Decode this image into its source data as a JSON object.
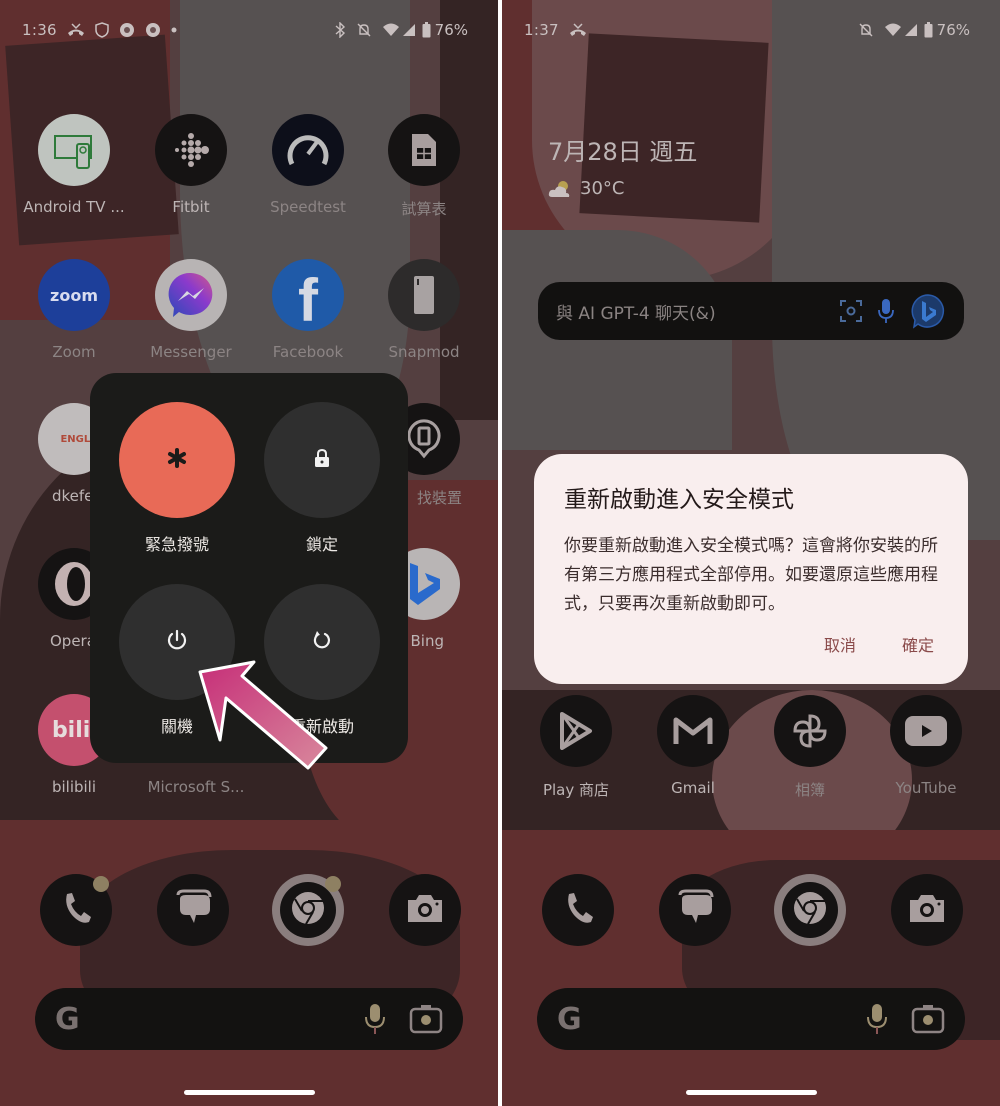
{
  "left_screen": {
    "status_bar": {
      "time": "1:36",
      "left_icons": [
        "missed-call-icon",
        "shield-icon",
        "chrome-icon",
        "chrome-icon",
        "dot-icon"
      ],
      "right_icons": [
        "bluetooth-icon",
        "bell-off-icon",
        "wifi-icon",
        "signal-icon",
        "battery-icon"
      ],
      "battery": "76%"
    },
    "apps": [
      {
        "label": "Android TV ...",
        "icon": "android-tv-remote-icon"
      },
      {
        "label": "Fitbit",
        "icon": "fitbit-icon"
      },
      {
        "label": "Speedtest",
        "icon": "speedtest-icon"
      },
      {
        "label": "試算表",
        "icon": "sheets-icon"
      },
      {
        "label": "Zoom",
        "icon": "zoom-icon",
        "icon_text": "zoom"
      },
      {
        "label": "Messenger",
        "icon": "messenger-icon"
      },
      {
        "label": "Facebook",
        "icon": "facebook-icon",
        "icon_text": "f"
      },
      {
        "label": "Snapmod",
        "icon": "snapmod-icon"
      },
      {
        "label": "dkefe",
        "icon": "dk-english-icon",
        "icon_text": "ENGLISH"
      },
      {
        "label": "找裝置",
        "icon": "find-device-icon"
      },
      {
        "label": "Opera",
        "icon": "opera-icon"
      },
      {
        "label": "Bing",
        "icon": "bing-icon"
      },
      {
        "label": "bilibili",
        "icon": "bilibili-icon",
        "icon_text": "bilib"
      },
      {
        "label": "Microsoft S...",
        "icon": "microsoft-s-icon"
      }
    ],
    "power_menu": {
      "emergency": "緊急撥號",
      "lock": "鎖定",
      "power_off": "關機",
      "restart": "重新啟動"
    },
    "dock": [
      "phone-icon",
      "messages-icon",
      "chrome-icon",
      "camera-icon"
    ],
    "search": {
      "logo": "G"
    }
  },
  "right_screen": {
    "status_bar": {
      "time": "1:37",
      "left_icons": [
        "missed-call-icon"
      ],
      "right_icons": [
        "bell-off-icon",
        "wifi-icon",
        "signal-icon",
        "battery-icon"
      ],
      "battery": "76%"
    },
    "date": "7月28日 週五",
    "weather": {
      "temp": "30°C",
      "icon": "partly-cloudy-icon"
    },
    "bing_bar": {
      "placeholder": "與 AI GPT-4 聊天(&)"
    },
    "dialog": {
      "title": "重新啟動進入安全模式",
      "body": "你要重新啟動進入安全模式嗎？這會將你安裝的所有第三方應用程式全部停用。如要還原這些應用程式，只要再次重新啟動即可。",
      "cancel": "取消",
      "confirm": "確定"
    },
    "apps": [
      {
        "label": "Play 商店",
        "icon": "play-store-icon"
      },
      {
        "label": "Gmail",
        "icon": "gmail-icon"
      },
      {
        "label": "相簿",
        "icon": "photos-icon"
      },
      {
        "label": "YouTube",
        "icon": "youtube-icon"
      }
    ],
    "dock": [
      "phone-icon",
      "messages-icon",
      "chrome-icon",
      "camera-icon"
    ],
    "search": {
      "logo": "G"
    }
  },
  "colors": {
    "emergency": "#e86a57",
    "power_menu_bg": "#1b1b19",
    "dialog_bg": "#f9eeee",
    "dialog_action": "#8a4a4a",
    "arrow": "#d04a86"
  }
}
